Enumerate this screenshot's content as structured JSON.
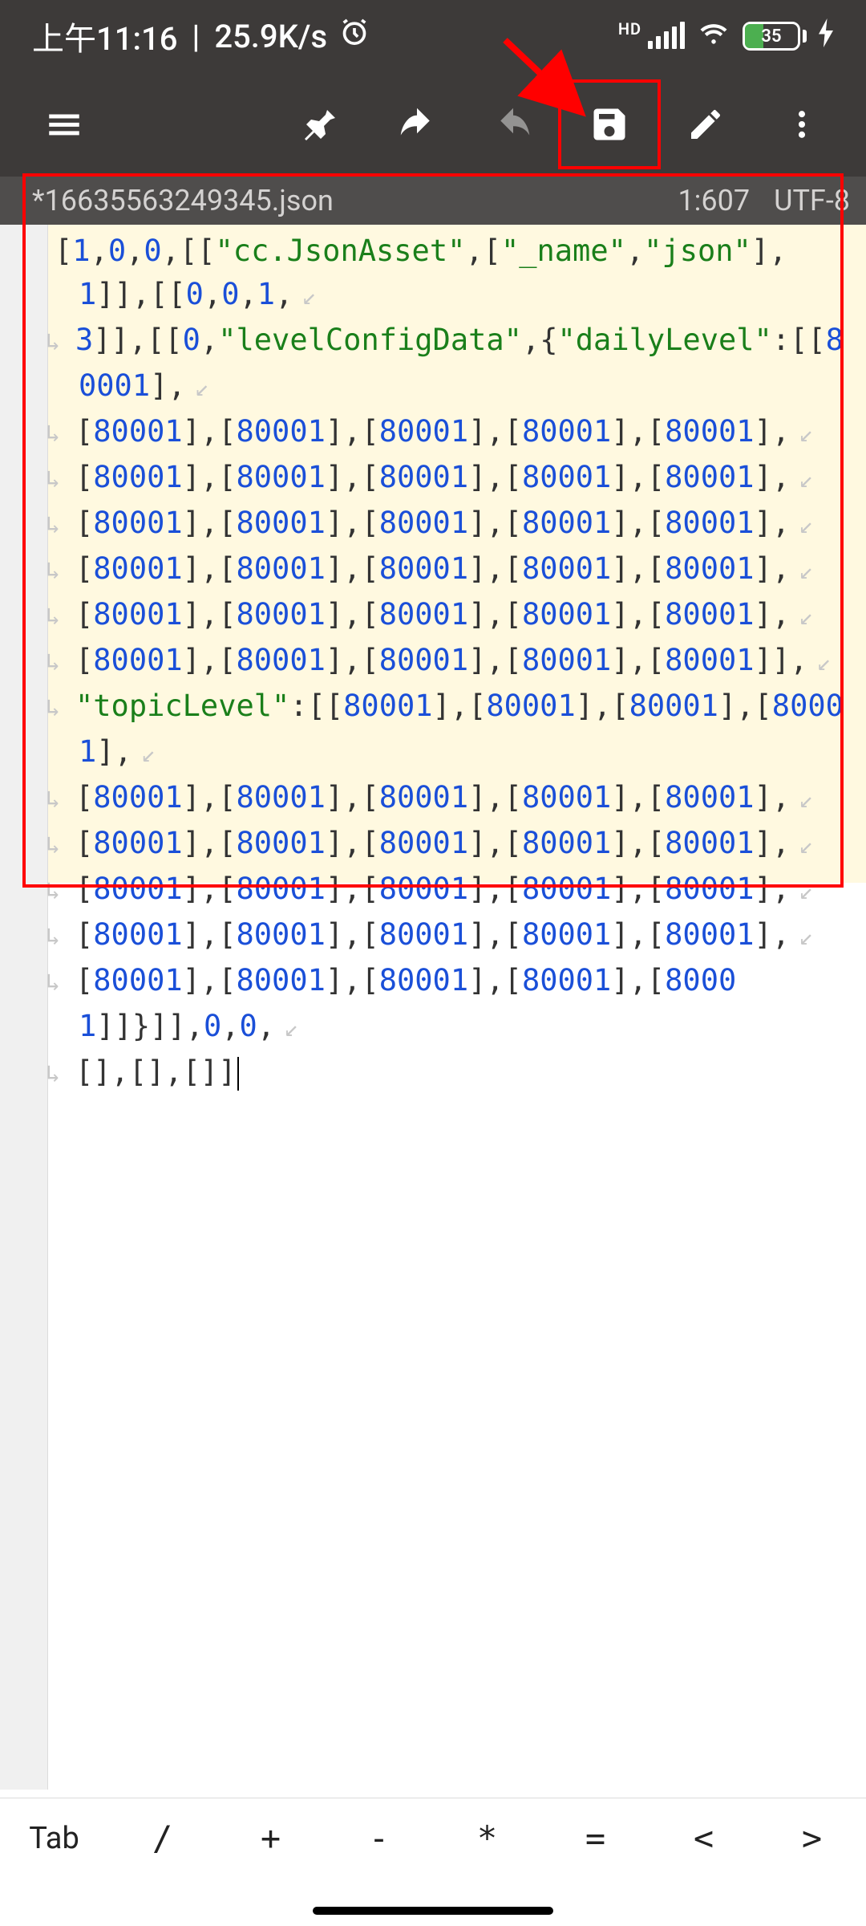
{
  "status": {
    "time": "上午11:16",
    "net_speed": "25.9K/s",
    "hd": "HD",
    "battery_pct": "35"
  },
  "file": {
    "name": "*16635563249345.json",
    "cursor": "1:607",
    "encoding": "UTF-8"
  },
  "code": {
    "tokens": [
      {
        "t": "p",
        "v": "["
      },
      {
        "t": "n",
        "v": "1"
      },
      {
        "t": "p",
        "v": ","
      },
      {
        "t": "n",
        "v": "0"
      },
      {
        "t": "p",
        "v": ","
      },
      {
        "t": "n",
        "v": "0"
      },
      {
        "t": "p",
        "v": ",[["
      },
      {
        "t": "s",
        "v": "\"cc.JsonAsset\""
      },
      {
        "t": "p",
        "v": ",["
      },
      {
        "t": "s",
        "v": "\"_name\""
      },
      {
        "t": "p",
        "v": ","
      },
      {
        "t": "s",
        "v": "\"json\""
      },
      {
        "t": "p",
        "v": "],"
      },
      {
        "t": "n",
        "v": "1"
      },
      {
        "t": "p",
        "v": "]],[["
      },
      {
        "t": "n",
        "v": "0"
      },
      {
        "t": "p",
        "v": ","
      },
      {
        "t": "n",
        "v": "0"
      },
      {
        "t": "p",
        "v": ","
      },
      {
        "t": "n",
        "v": "1"
      },
      {
        "t": "p",
        "v": ","
      },
      {
        "t": "wrap"
      },
      {
        "t": "n",
        "v": "3"
      },
      {
        "t": "p",
        "v": "]],[["
      },
      {
        "t": "n",
        "v": "0"
      },
      {
        "t": "p",
        "v": ","
      },
      {
        "t": "s",
        "v": "\"levelConfigData\""
      },
      {
        "t": "p",
        "v": ",{"
      },
      {
        "t": "s",
        "v": "\"dailyLevel\""
      },
      {
        "t": "p",
        "v": ":[["
      },
      {
        "t": "n",
        "v": "80001"
      },
      {
        "t": "p",
        "v": "],"
      },
      {
        "t": "wrap"
      },
      {
        "t": "p",
        "v": "["
      },
      {
        "t": "n",
        "v": "80001"
      },
      {
        "t": "p",
        "v": "],["
      },
      {
        "t": "n",
        "v": "80001"
      },
      {
        "t": "p",
        "v": "],["
      },
      {
        "t": "n",
        "v": "80001"
      },
      {
        "t": "p",
        "v": "],["
      },
      {
        "t": "n",
        "v": "80001"
      },
      {
        "t": "p",
        "v": "],["
      },
      {
        "t": "n",
        "v": "80001"
      },
      {
        "t": "p",
        "v": "],"
      },
      {
        "t": "wrap"
      },
      {
        "t": "p",
        "v": "["
      },
      {
        "t": "n",
        "v": "80001"
      },
      {
        "t": "p",
        "v": "],["
      },
      {
        "t": "n",
        "v": "80001"
      },
      {
        "t": "p",
        "v": "],["
      },
      {
        "t": "n",
        "v": "80001"
      },
      {
        "t": "p",
        "v": "],["
      },
      {
        "t": "n",
        "v": "80001"
      },
      {
        "t": "p",
        "v": "],["
      },
      {
        "t": "n",
        "v": "80001"
      },
      {
        "t": "p",
        "v": "],"
      },
      {
        "t": "wrap"
      },
      {
        "t": "p",
        "v": "["
      },
      {
        "t": "n",
        "v": "80001"
      },
      {
        "t": "p",
        "v": "],["
      },
      {
        "t": "n",
        "v": "80001"
      },
      {
        "t": "p",
        "v": "],["
      },
      {
        "t": "n",
        "v": "80001"
      },
      {
        "t": "p",
        "v": "],["
      },
      {
        "t": "n",
        "v": "80001"
      },
      {
        "t": "p",
        "v": "],["
      },
      {
        "t": "n",
        "v": "80001"
      },
      {
        "t": "p",
        "v": "],"
      },
      {
        "t": "wrap"
      },
      {
        "t": "p",
        "v": "["
      },
      {
        "t": "n",
        "v": "80001"
      },
      {
        "t": "p",
        "v": "],["
      },
      {
        "t": "n",
        "v": "80001"
      },
      {
        "t": "p",
        "v": "],["
      },
      {
        "t": "n",
        "v": "80001"
      },
      {
        "t": "p",
        "v": "],["
      },
      {
        "t": "n",
        "v": "80001"
      },
      {
        "t": "p",
        "v": "],["
      },
      {
        "t": "n",
        "v": "80001"
      },
      {
        "t": "p",
        "v": "],"
      },
      {
        "t": "wrap"
      },
      {
        "t": "p",
        "v": "["
      },
      {
        "t": "n",
        "v": "80001"
      },
      {
        "t": "p",
        "v": "],["
      },
      {
        "t": "n",
        "v": "80001"
      },
      {
        "t": "p",
        "v": "],["
      },
      {
        "t": "n",
        "v": "80001"
      },
      {
        "t": "p",
        "v": "],["
      },
      {
        "t": "n",
        "v": "80001"
      },
      {
        "t": "p",
        "v": "],["
      },
      {
        "t": "n",
        "v": "80001"
      },
      {
        "t": "p",
        "v": "],"
      },
      {
        "t": "wrap"
      },
      {
        "t": "p",
        "v": "["
      },
      {
        "t": "n",
        "v": "80001"
      },
      {
        "t": "p",
        "v": "],["
      },
      {
        "t": "n",
        "v": "80001"
      },
      {
        "t": "p",
        "v": "],["
      },
      {
        "t": "n",
        "v": "80001"
      },
      {
        "t": "p",
        "v": "],["
      },
      {
        "t": "n",
        "v": "80001"
      },
      {
        "t": "p",
        "v": "],["
      },
      {
        "t": "n",
        "v": "80001"
      },
      {
        "t": "p",
        "v": "]],"
      },
      {
        "t": "wrap"
      },
      {
        "t": "s",
        "v": "\"topicLevel\""
      },
      {
        "t": "p",
        "v": ":[["
      },
      {
        "t": "n",
        "v": "80001"
      },
      {
        "t": "p",
        "v": "],["
      },
      {
        "t": "n",
        "v": "80001"
      },
      {
        "t": "p",
        "v": "],["
      },
      {
        "t": "n",
        "v": "80001"
      },
      {
        "t": "p",
        "v": "],["
      },
      {
        "t": "n",
        "v": "80001"
      },
      {
        "t": "p",
        "v": "],"
      },
      {
        "t": "wrap"
      },
      {
        "t": "p",
        "v": "["
      },
      {
        "t": "n",
        "v": "80001"
      },
      {
        "t": "p",
        "v": "],["
      },
      {
        "t": "n",
        "v": "80001"
      },
      {
        "t": "p",
        "v": "],["
      },
      {
        "t": "n",
        "v": "80001"
      },
      {
        "t": "p",
        "v": "],["
      },
      {
        "t": "n",
        "v": "80001"
      },
      {
        "t": "p",
        "v": "],["
      },
      {
        "t": "n",
        "v": "80001"
      },
      {
        "t": "p",
        "v": "],"
      },
      {
        "t": "wrap"
      },
      {
        "t": "p",
        "v": "["
      },
      {
        "t": "n",
        "v": "80001"
      },
      {
        "t": "p",
        "v": "],["
      },
      {
        "t": "n",
        "v": "80001"
      },
      {
        "t": "p",
        "v": "],["
      },
      {
        "t": "n",
        "v": "80001"
      },
      {
        "t": "p",
        "v": "],["
      },
      {
        "t": "n",
        "v": "80001"
      },
      {
        "t": "p",
        "v": "],["
      },
      {
        "t": "n",
        "v": "80001"
      },
      {
        "t": "p",
        "v": "],"
      },
      {
        "t": "wrap"
      },
      {
        "t": "p",
        "v": "["
      },
      {
        "t": "n",
        "v": "80001"
      },
      {
        "t": "p",
        "v": "],["
      },
      {
        "t": "n",
        "v": "80001"
      },
      {
        "t": "p",
        "v": "],["
      },
      {
        "t": "n",
        "v": "80001"
      },
      {
        "t": "p",
        "v": "],["
      },
      {
        "t": "n",
        "v": "80001"
      },
      {
        "t": "p",
        "v": "],["
      },
      {
        "t": "n",
        "v": "80001"
      },
      {
        "t": "p",
        "v": "],"
      },
      {
        "t": "wrap"
      },
      {
        "t": "p",
        "v": "["
      },
      {
        "t": "n",
        "v": "80001"
      },
      {
        "t": "p",
        "v": "],["
      },
      {
        "t": "n",
        "v": "80001"
      },
      {
        "t": "p",
        "v": "],["
      },
      {
        "t": "n",
        "v": "80001"
      },
      {
        "t": "p",
        "v": "],["
      },
      {
        "t": "n",
        "v": "80001"
      },
      {
        "t": "p",
        "v": "],["
      },
      {
        "t": "n",
        "v": "80001"
      },
      {
        "t": "p",
        "v": "],"
      },
      {
        "t": "wrap"
      },
      {
        "t": "p",
        "v": "["
      },
      {
        "t": "n",
        "v": "80001"
      },
      {
        "t": "p",
        "v": "],["
      },
      {
        "t": "n",
        "v": "80001"
      },
      {
        "t": "p",
        "v": "],["
      },
      {
        "t": "n",
        "v": "80001"
      },
      {
        "t": "p",
        "v": "],["
      },
      {
        "t": "n",
        "v": "80001"
      },
      {
        "t": "p",
        "v": "],["
      },
      {
        "t": "n",
        "v": "80001"
      },
      {
        "t": "p",
        "v": "]]}]],"
      },
      {
        "t": "n",
        "v": "0"
      },
      {
        "t": "p",
        "v": ","
      },
      {
        "t": "n",
        "v": "0"
      },
      {
        "t": "p",
        "v": ","
      },
      {
        "t": "wrap"
      },
      {
        "t": "p",
        "v": "[],[],[]]"
      }
    ]
  },
  "bottom": {
    "keys": [
      "Tab",
      "/",
      "+",
      "-",
      "*",
      "=",
      "<",
      ">"
    ]
  }
}
